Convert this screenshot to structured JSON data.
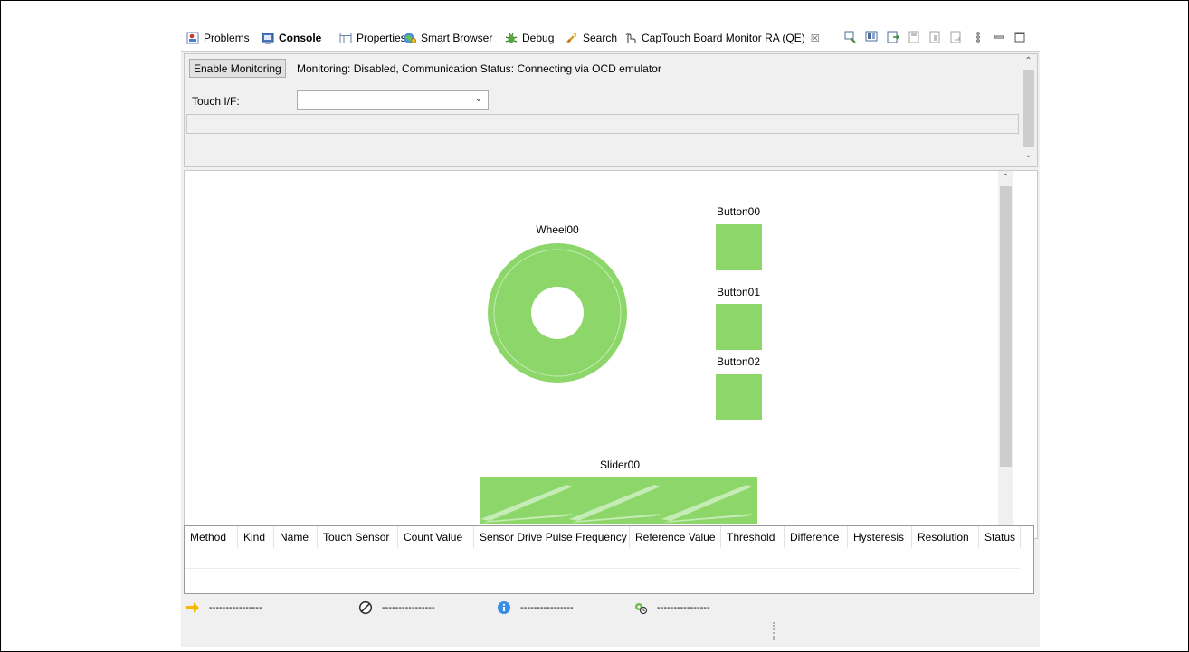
{
  "tabs": [
    {
      "label": "Problems",
      "icon": "problems-icon"
    },
    {
      "label": "Console",
      "icon": "console-icon",
      "active": true
    },
    {
      "label": "Properties",
      "icon": "properties-icon"
    },
    {
      "label": "Smart Browser",
      "icon": "smart-browser-icon"
    },
    {
      "label": "Debug",
      "icon": "debug-icon"
    },
    {
      "label": "Search",
      "icon": "search-icon"
    },
    {
      "label": "CapTouch Board Monitor RA (QE)",
      "icon": "captouch-icon",
      "selected": true,
      "close": "☒"
    }
  ],
  "monitor": {
    "enable_label": "Enable Monitoring",
    "status": "Monitoring: Disabled, Communication Status: Connecting via OCD emulator",
    "touch_if_label": "Touch I/F:",
    "touch_if_value": ""
  },
  "canvas": {
    "wheel_label": "Wheel00",
    "button00_label": "Button00",
    "button01_label": "Button01",
    "button02_label": "Button02",
    "slider_label": "Slider00",
    "element_color": "#8cd66a",
    "highlight_color": "#c5ecb4"
  },
  "table": {
    "columns": [
      "Method",
      "Kind",
      "Name",
      "Touch Sensor",
      "Count Value",
      "Sensor Drive Pulse Frequency",
      "Reference Value",
      "Threshold",
      "Difference",
      "Hysteresis",
      "Resolution",
      "Status"
    ]
  },
  "statusbar": {
    "items": [
      {
        "icon": "arrow-right-icon",
        "text": "----------------"
      },
      {
        "icon": "no-entry-icon",
        "text": "----------------"
      },
      {
        "icon": "info-icon",
        "text": "----------------"
      },
      {
        "icon": "gear-network-icon",
        "text": "----------------"
      }
    ]
  }
}
